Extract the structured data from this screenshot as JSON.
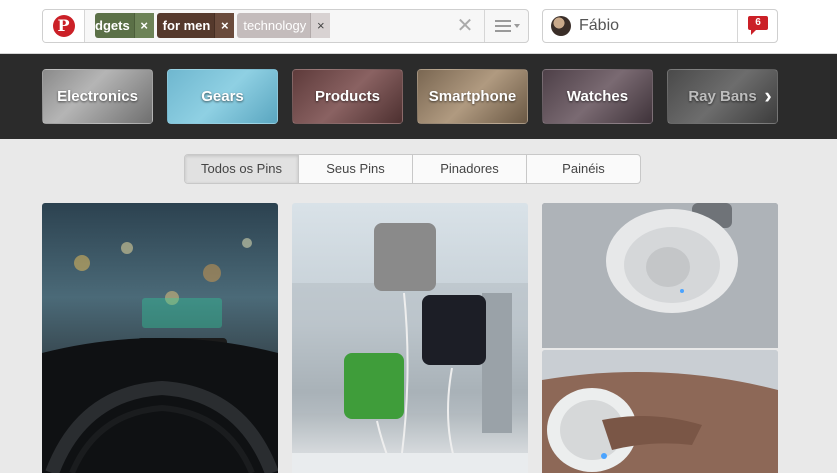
{
  "header": {
    "search_tags": [
      {
        "label": "dgets",
        "remove": "×"
      },
      {
        "label": "for men",
        "remove": "×"
      },
      {
        "label": "technology",
        "remove": "×"
      }
    ],
    "clear_glyph": "✕",
    "user": {
      "name": "Fábio",
      "notifications": "6"
    }
  },
  "categories": [
    {
      "label": "Electronics"
    },
    {
      "label": "Gears"
    },
    {
      "label": "Products"
    },
    {
      "label": "Smartphone"
    },
    {
      "label": "Watches"
    },
    {
      "label": "Ray Bans"
    }
  ],
  "next_glyph": "›",
  "tabs": [
    {
      "label": "Todos os Pins",
      "active": true
    },
    {
      "label": "Seus Pins",
      "active": false
    },
    {
      "label": "Pinadores",
      "active": false
    },
    {
      "label": "Painéis",
      "active": false
    }
  ],
  "colors": {
    "brand": "#cb2027",
    "category_bar": "#2b2b2b",
    "page_bg": "#e9e9e9"
  }
}
